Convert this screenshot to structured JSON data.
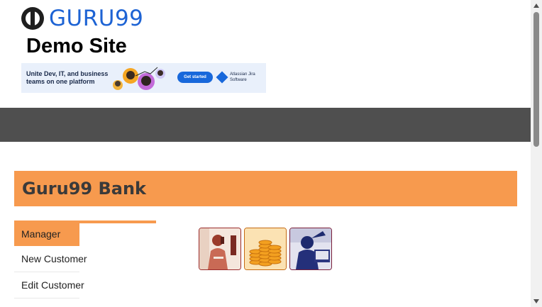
{
  "header": {
    "logo_text": "GURU99",
    "site_title": "Demo Site"
  },
  "ad": {
    "headline": "Unite Dev, IT, and business teams on one platform",
    "cta_label": "Get started",
    "brand_text": "Atlassian Jira Software"
  },
  "bank": {
    "title": "Guru99 Bank"
  },
  "menu": {
    "items": [
      {
        "label": "Manager"
      },
      {
        "label": "New Customer"
      },
      {
        "label": "Edit Customer"
      }
    ]
  },
  "images": [
    {
      "icon": "man-on-phone-image"
    },
    {
      "icon": "stacked-coins-image"
    },
    {
      "icon": "woman-at-desk-image"
    }
  ],
  "colors": {
    "accent": "#f79a4e",
    "nav": "#4f4f4f",
    "logo": "#1d63d4"
  }
}
